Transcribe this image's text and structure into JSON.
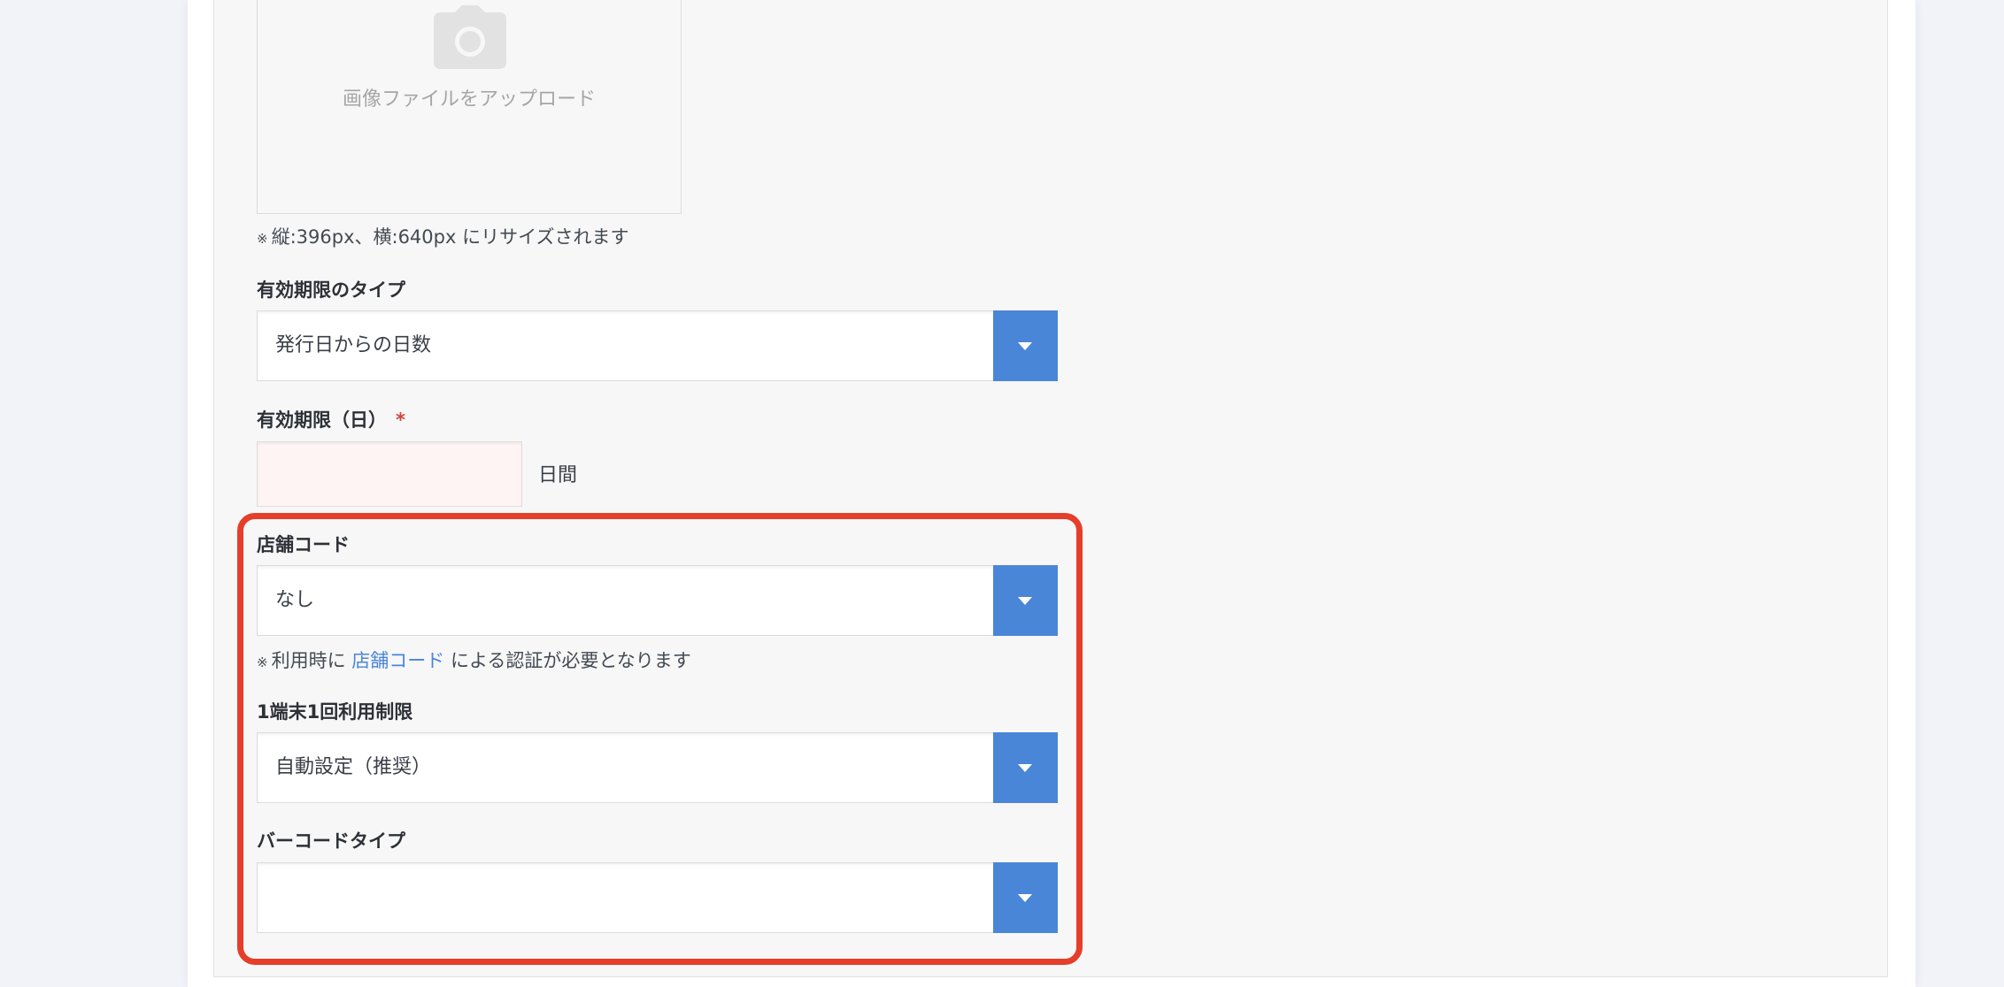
{
  "upload": {
    "icon": "camera-icon",
    "text": "画像ファイルをアップロード",
    "note": "縦:396px、横:640px にリサイズされます"
  },
  "note_mark": "※",
  "expiry_type": {
    "label": "有効期限のタイプ",
    "value": "発行日からの日数"
  },
  "expiry_days": {
    "label": "有効期限（日）",
    "required_mark": "*",
    "value": "",
    "suffix": "日間"
  },
  "store_code": {
    "label": "店舗コード",
    "value": "なし",
    "note_before": "利用時に",
    "note_link": "店舗コード",
    "note_after": "による認証が必要となります"
  },
  "device_limit": {
    "label": "1端末1回利用制限",
    "value": "自動設定（推奨）"
  },
  "barcode_type": {
    "label": "バーコードタイプ",
    "value": ""
  },
  "colors": {
    "accent": "#4a86d8",
    "highlight": "#e53e2a",
    "required": "#d0463a"
  }
}
